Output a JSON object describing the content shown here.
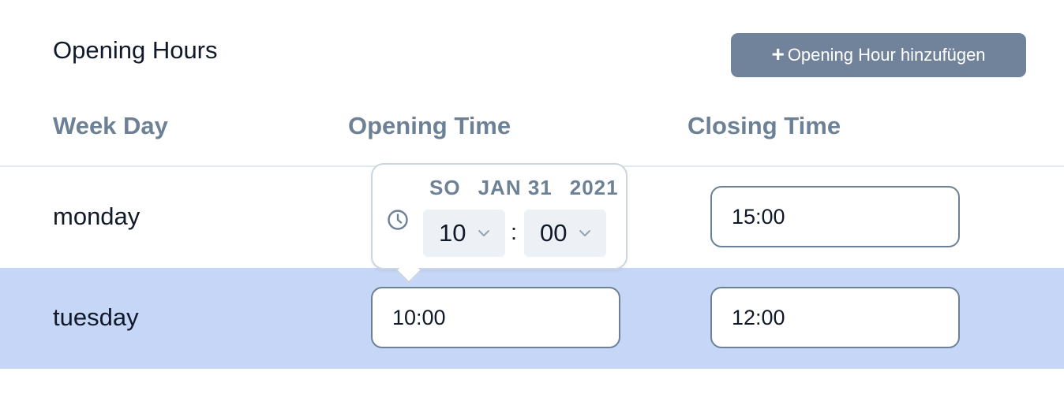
{
  "header": {
    "title": "Opening Hours",
    "add_button_label": "Opening Hour hinzufügen"
  },
  "table": {
    "columns": [
      "Week Day",
      "Opening Time",
      "Closing Time"
    ],
    "rows": [
      {
        "day": "monday",
        "opening": "",
        "closing": "15:00",
        "selected": false
      },
      {
        "day": "tuesday",
        "opening": "10:00",
        "closing": "12:00",
        "selected": true
      }
    ]
  },
  "time_picker": {
    "weekday": "SO",
    "month_day": "JAN 31",
    "year": "2021",
    "hour": "10",
    "separator": ":",
    "minute": "00"
  },
  "icons": {
    "add": "plus-icon",
    "time": "clock-icon",
    "hour_select": "chevron-down-icon",
    "minute_select": "chevron-down-icon"
  },
  "colors": {
    "button_bg": "#71839a",
    "header_text": "#6d8196",
    "selected_row_bg": "#c6d6f7",
    "input_border": "#6d8196"
  }
}
